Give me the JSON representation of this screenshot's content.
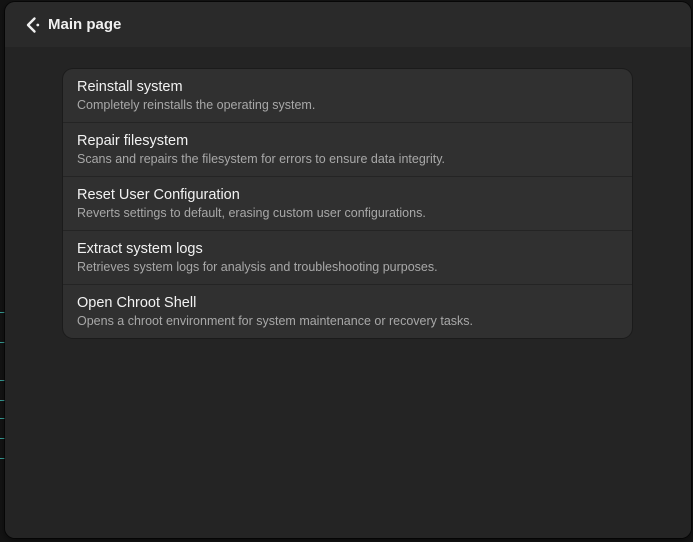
{
  "header": {
    "back_label": "Main page",
    "back_icon": "chevron-left-icon"
  },
  "menu": {
    "items": [
      {
        "title": "Reinstall system",
        "subtitle": "Completely reinstalls the operating system."
      },
      {
        "title": "Repair filesystem",
        "subtitle": "Scans and repairs the filesystem for errors to ensure data integrity."
      },
      {
        "title": "Reset User Configuration",
        "subtitle": "Reverts settings to default, erasing custom user configurations."
      },
      {
        "title": "Extract system logs",
        "subtitle": "Retrieves system logs for analysis and troubleshooting purposes."
      },
      {
        "title": "Open Chroot Shell",
        "subtitle": "Opens a chroot environment for system maintenance or recovery tasks."
      }
    ]
  },
  "colors": {
    "window_bg": "#242424",
    "header_bg": "#2a2a2a",
    "card_bg": "#303030",
    "title_text": "#f2f2f2",
    "subtitle_text": "#a8a8a8"
  }
}
